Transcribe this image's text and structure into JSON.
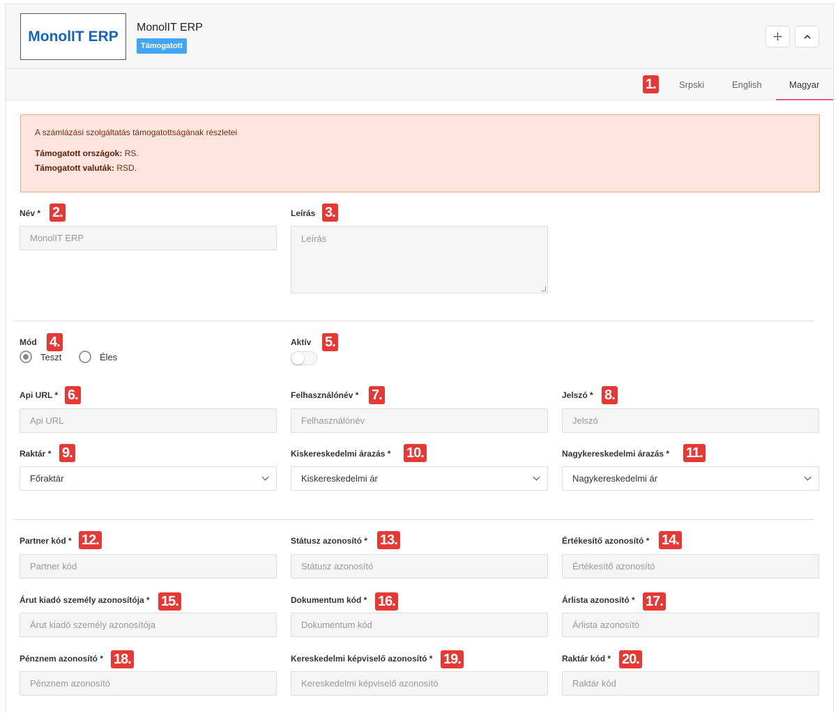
{
  "header": {
    "logo_text": "MonolIT ERP",
    "title": "MonolIT ERP",
    "badge": "Támogatott",
    "move_icon": "move-icon",
    "collapse_icon": "chevron-up-icon"
  },
  "tabs": [
    {
      "label": "Srpski"
    },
    {
      "label": "English"
    },
    {
      "label": "Magyar",
      "active": true
    }
  ],
  "alert": {
    "title": "A számlázási szolgáltatás támogatottságának részletei",
    "countries_label": "Támogatott országok:",
    "countries_value": "RS.",
    "currencies_label": "Támogatott valuták:",
    "currencies_value": "RSD."
  },
  "markers": [
    "1.",
    "2.",
    "3.",
    "4.",
    "5.",
    "6.",
    "7.",
    "8.",
    "9.",
    "10.",
    "11.",
    "12.",
    "13.",
    "14.",
    "15.",
    "16.",
    "17.",
    "18.",
    "19.",
    "20."
  ],
  "form": {
    "name": {
      "label": "Név *",
      "value": "MonolIT ERP"
    },
    "description": {
      "label": "Leírás",
      "placeholder": "Leírás"
    },
    "mode": {
      "label": "Mód",
      "options": [
        "Teszt",
        "Éles"
      ],
      "selected": "Teszt"
    },
    "active": {
      "label": "Aktív",
      "value": false
    },
    "api_url": {
      "label": "Api URL *",
      "placeholder": "Api URL"
    },
    "username": {
      "label": "Felhasználónév *",
      "placeholder": "Felhasználónév"
    },
    "password": {
      "label": "Jelszó *",
      "placeholder": "Jelszó"
    },
    "warehouse": {
      "label": "Raktár *",
      "value": "Főraktár"
    },
    "retail_pricing": {
      "label": "Kiskereskedelmi árazás *",
      "value": "Kiskereskedelmi ár"
    },
    "wholesale_pricing": {
      "label": "Nagykereskedelmi árazás *",
      "value": "Nagykereskedelmi ár"
    },
    "partner_code": {
      "label": "Partner kód *",
      "placeholder": "Partner kód"
    },
    "status_id": {
      "label": "Státusz azonosító *",
      "placeholder": "Státusz azonosító"
    },
    "seller_id": {
      "label": "Értékesítő azonosító *",
      "placeholder": "Értékesítő azonosító"
    },
    "issuer_id": {
      "label": "Árut kiadó személy azonosítója *",
      "placeholder": "Árut kiadó személy azonosítója"
    },
    "document_code": {
      "label": "Dokumentum kód *",
      "placeholder": "Dokumentum kód"
    },
    "pricelist_id": {
      "label": "Árlista azonosító *",
      "placeholder": "Árlista azonosító"
    },
    "currency_id": {
      "label": "Pénznem azonosító *",
      "placeholder": "Pénznem azonosító"
    },
    "sales_rep_id": {
      "label": "Kereskedelmi képviselő azonosító *",
      "placeholder": "Kereskedelmi képviselő azonosító"
    },
    "warehouse_code": {
      "label": "Raktár kód *",
      "placeholder": "Raktár kód"
    }
  },
  "colors": {
    "badge": "#42a5f5",
    "logo": "#1565c0",
    "marker": "#e53935",
    "tab_underline": "#e75a86",
    "alert_bg": "#fde4dc",
    "alert_border": "#f3a382"
  }
}
